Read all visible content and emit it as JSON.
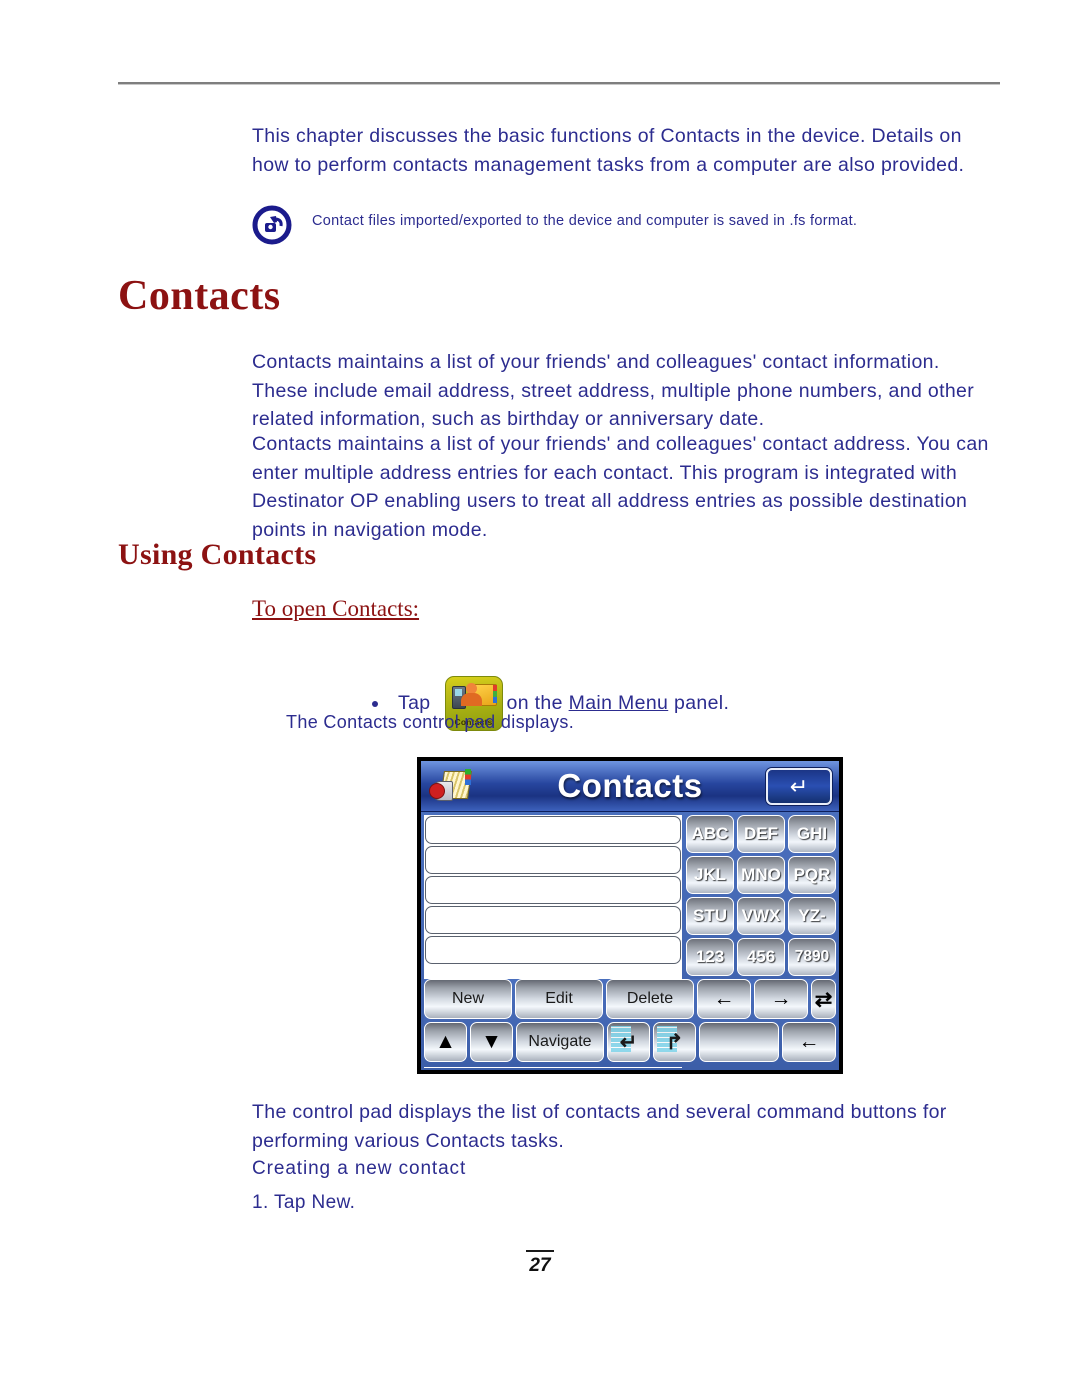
{
  "page": {
    "number": "27"
  },
  "intro": {
    "paragraph": "This chapter discusses the basic functions of Contacts in the device. Details on how to perform contacts management tasks from a computer are also provided."
  },
  "note": {
    "icon": "note-hand-icon",
    "text": "Contact files imported/exported to the device and computer is saved in  .fs format."
  },
  "headings": {
    "h1": "Contacts",
    "h2": "Using Contacts",
    "to_open": "To open Contacts:",
    "creating": "Creating a new contact"
  },
  "paragraphs": {
    "a": "Contacts maintains a list of your friends' and colleagues' contact information. These include email address, street address, multiple phone numbers, and other related information, such as birthday or anniversary date.",
    "b": "Contacts maintains a list of your friends' and colleagues' contact address. You can enter multiple address entries for each contact. This program is integrated with Destinator OP enabling users to treat all address entries as possible destination points in navigation mode.",
    "c": "The control pad displays the list of contacts and several command buttons for performing various Contacts tasks."
  },
  "bullet": {
    "tap": "Tap",
    "app_icon_label": "Contacts",
    "on_the": "on the",
    "link": "Main Menu",
    "panel": "panel.",
    "sub": "The Contacts control pad displays."
  },
  "steps": {
    "step1": "1.  Tap New."
  },
  "device": {
    "title": "Contacts",
    "header_icon": "rolodex-icon",
    "back_key": "↵",
    "contact_rows": [
      "",
      "",
      "",
      "",
      ""
    ],
    "keypad": [
      "ABC",
      "DEF",
      "GHI",
      "JKL",
      "MNO",
      "PQR",
      "STU",
      "VWX",
      "YZ-",
      "123",
      "456",
      "7890"
    ],
    "commands": {
      "new": "New",
      "edit": "Edit",
      "delete": "Delete",
      "prev_arrow": "←",
      "next_arrow": "→",
      "sync": "⇄",
      "up_arrow": "▲",
      "down_arrow": "▼",
      "navigate": "Navigate",
      "kb_left": "↵",
      "kb_right": "↱",
      "blank": "",
      "back_arrow": "←"
    }
  },
  "colors": {
    "body_text": "#2c2c8f",
    "heading": "#8c1212",
    "device_header": "#27469f",
    "app_icon": "#a8b012"
  }
}
